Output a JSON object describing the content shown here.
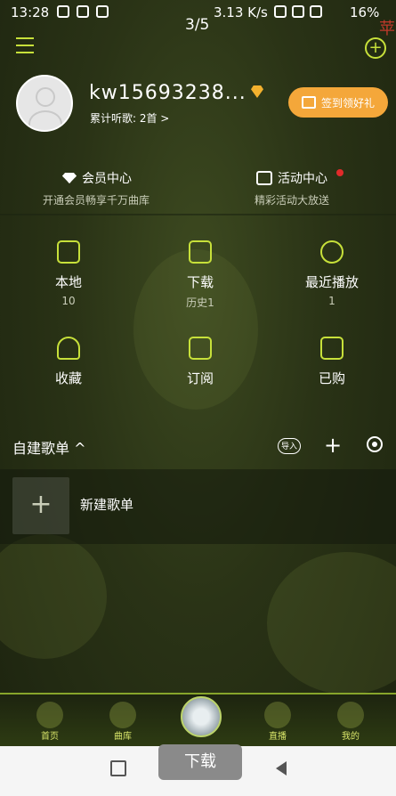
{
  "status": {
    "time": "13:28",
    "speed": "3.13 K/s",
    "battery": "16%"
  },
  "header": {
    "page_indicator": "3/5",
    "red_char": "苹"
  },
  "profile": {
    "username": "kw15693238...",
    "listen_count": "累计听歌: 2首 >",
    "checkin_label": "签到领好礼"
  },
  "vip": {
    "title": "会员中心",
    "subtitle": "开通会员畅享千万曲库"
  },
  "activity": {
    "title": "活动中心",
    "subtitle": "精彩活动大放送"
  },
  "grid": [
    {
      "label": "本地",
      "count": "10",
      "icon": "music-note-icon"
    },
    {
      "label": "下载",
      "count": "历史1",
      "icon": "download-icon"
    },
    {
      "label": "最近播放",
      "count": "1",
      "icon": "clock-icon"
    },
    {
      "label": "收藏",
      "count": "",
      "icon": "heart-icon"
    },
    {
      "label": "订阅",
      "count": "",
      "icon": "subscribe-icon"
    },
    {
      "label": "已购",
      "count": "",
      "icon": "purchased-icon"
    }
  ],
  "playlist": {
    "title": "自建歌单 ^",
    "import_label": "导入",
    "new_label": "新建歌单"
  },
  "tabs": [
    {
      "label": "首页"
    },
    {
      "label": "曲库"
    },
    {
      "label": "直播"
    },
    {
      "label": "我的"
    }
  ],
  "toast": "下载",
  "colors": {
    "accent": "#c7e03a",
    "checkin": "#f4a73a",
    "vip": "#f3b12e",
    "background": "#2a3316"
  }
}
